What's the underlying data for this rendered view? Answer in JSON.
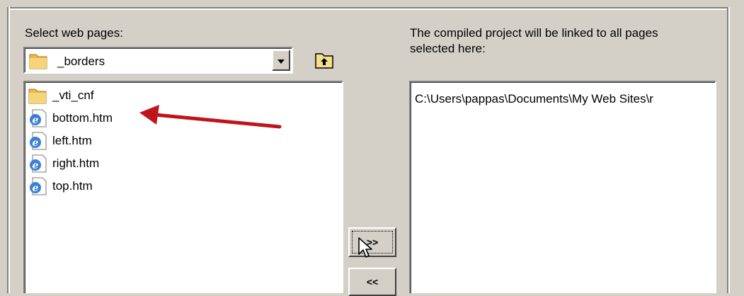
{
  "left_panel": {
    "label": "Select web pages:",
    "combo_value": "_borders",
    "items": [
      {
        "label": "_vti_cnf",
        "icon": "folder-icon"
      },
      {
        "label": "bottom.htm",
        "icon": "ie-page-icon"
      },
      {
        "label": "left.htm",
        "icon": "ie-page-icon"
      },
      {
        "label": "right.htm",
        "icon": "ie-page-icon"
      },
      {
        "label": "top.htm",
        "icon": "ie-page-icon"
      }
    ]
  },
  "right_panel": {
    "label_line1": "The compiled project will be linked to all pages",
    "label_line2": "selected here:",
    "items": [
      "C:\\Users\\pappas\\Documents\\My Web Sites\\r"
    ]
  },
  "buttons": {
    "add": ">>",
    "remove": "<<"
  },
  "colors": {
    "annotation_arrow": "#c0141b",
    "dialog_bg": "#d4d0c8"
  }
}
